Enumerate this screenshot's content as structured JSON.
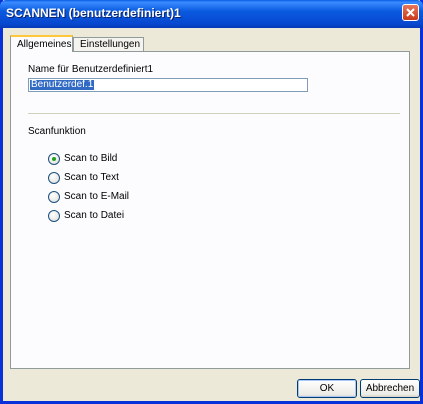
{
  "window": {
    "title": "SCANNEN (benutzerdefiniert)1",
    "close_icon": "close-icon"
  },
  "tabs": [
    {
      "label": "Allgemeines",
      "active": true
    },
    {
      "label": "Einstellungen",
      "active": false
    }
  ],
  "general": {
    "name_label": "Name für Benutzerdefiniert1",
    "name_value": "Benutzerdef.1",
    "scan_function_label": "Scanfunktion",
    "options": [
      {
        "label": "Scan to Bild",
        "selected": true
      },
      {
        "label": "Scan to Text",
        "selected": false
      },
      {
        "label": "Scan to E-Mail",
        "selected": false
      },
      {
        "label": "Scan to Datei",
        "selected": false
      }
    ]
  },
  "buttons": {
    "ok": "OK",
    "cancel": "Abbrechen"
  }
}
